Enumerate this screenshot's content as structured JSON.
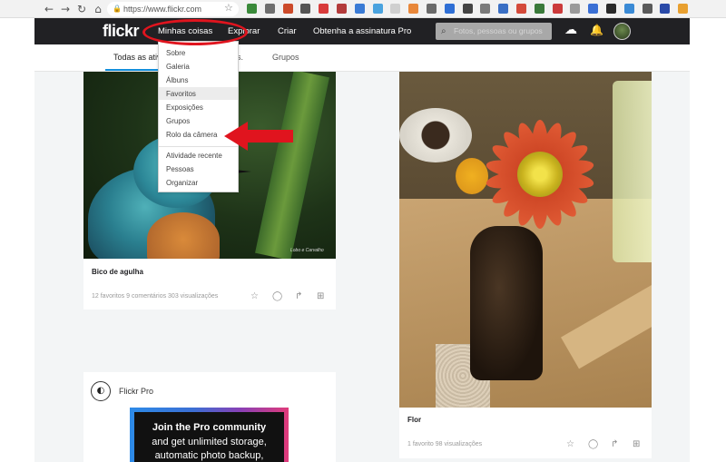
{
  "browser": {
    "url": "https://www.flickr.com",
    "back_glyph": "←",
    "forward_glyph": "→",
    "reload_glyph": "↻",
    "home_glyph": "⌂",
    "lock_glyph": "🔒",
    "star_glyph": "☆",
    "extension_colors": [
      "#3a8a3a",
      "#6e6e6e",
      "#cc4a2a",
      "#555555",
      "#d83b3b",
      "#b33b3b",
      "#3a7bd5",
      "#4aa3df",
      "#cfcfcf",
      "#e8873a",
      "#6a6a6a",
      "#2f6fd5",
      "#444444",
      "#7a7a7a",
      "#3a6fc4",
      "#d44a3a",
      "#3a7a3a",
      "#cc3a3a",
      "#9a9a9a",
      "#3a6fd4",
      "#2a2a2a",
      "#3a8ad5",
      "#5a5a5a",
      "#2a4aa8",
      "#e8a030"
    ]
  },
  "topbar": {
    "logo": "flickr",
    "nav": [
      "Minhas coisas",
      "Explorar",
      "Criar",
      "Obtenha a assinatura Pro"
    ],
    "search_placeholder": "Fotos, pessoas ou grupos",
    "search_icon": "search-icon",
    "upload_glyph": "☁",
    "bell_glyph": "🔔"
  },
  "subnav": {
    "tabs": [
      "Todas as ativ",
      "s.",
      "Grupos"
    ]
  },
  "dropdown": {
    "items": [
      "Sobre",
      "Galeria",
      "Álbuns",
      "Favoritos",
      "Exposições",
      "Grupos",
      "Rolo da câmera"
    ],
    "items2": [
      "Atividade recente",
      "Pessoas",
      "Organizar"
    ],
    "highlighted": "Favoritos"
  },
  "posts": [
    {
      "caption": "Bico de agulha",
      "stats": "12 favoritos   9 comentários   303 visualizações",
      "watermark": "Lobo e Carvalho"
    },
    {
      "caption": "Flor",
      "stats": "1 favorito   98 visualizações"
    }
  ],
  "actions": {
    "fave_glyph": "☆",
    "comment_glyph": "◯",
    "share_glyph": "↱",
    "add_glyph": "⊞"
  },
  "pro": {
    "title": "Flickr Pro",
    "logo_glyph": "◐",
    "line1": "Join the Pro community",
    "line2": "and get unlimited storage,",
    "line3": "automatic photo backup,"
  },
  "colors": {
    "flickr_bar": "#212124",
    "highlight_red": "#e0141e",
    "accent_blue": "#128fdc"
  }
}
